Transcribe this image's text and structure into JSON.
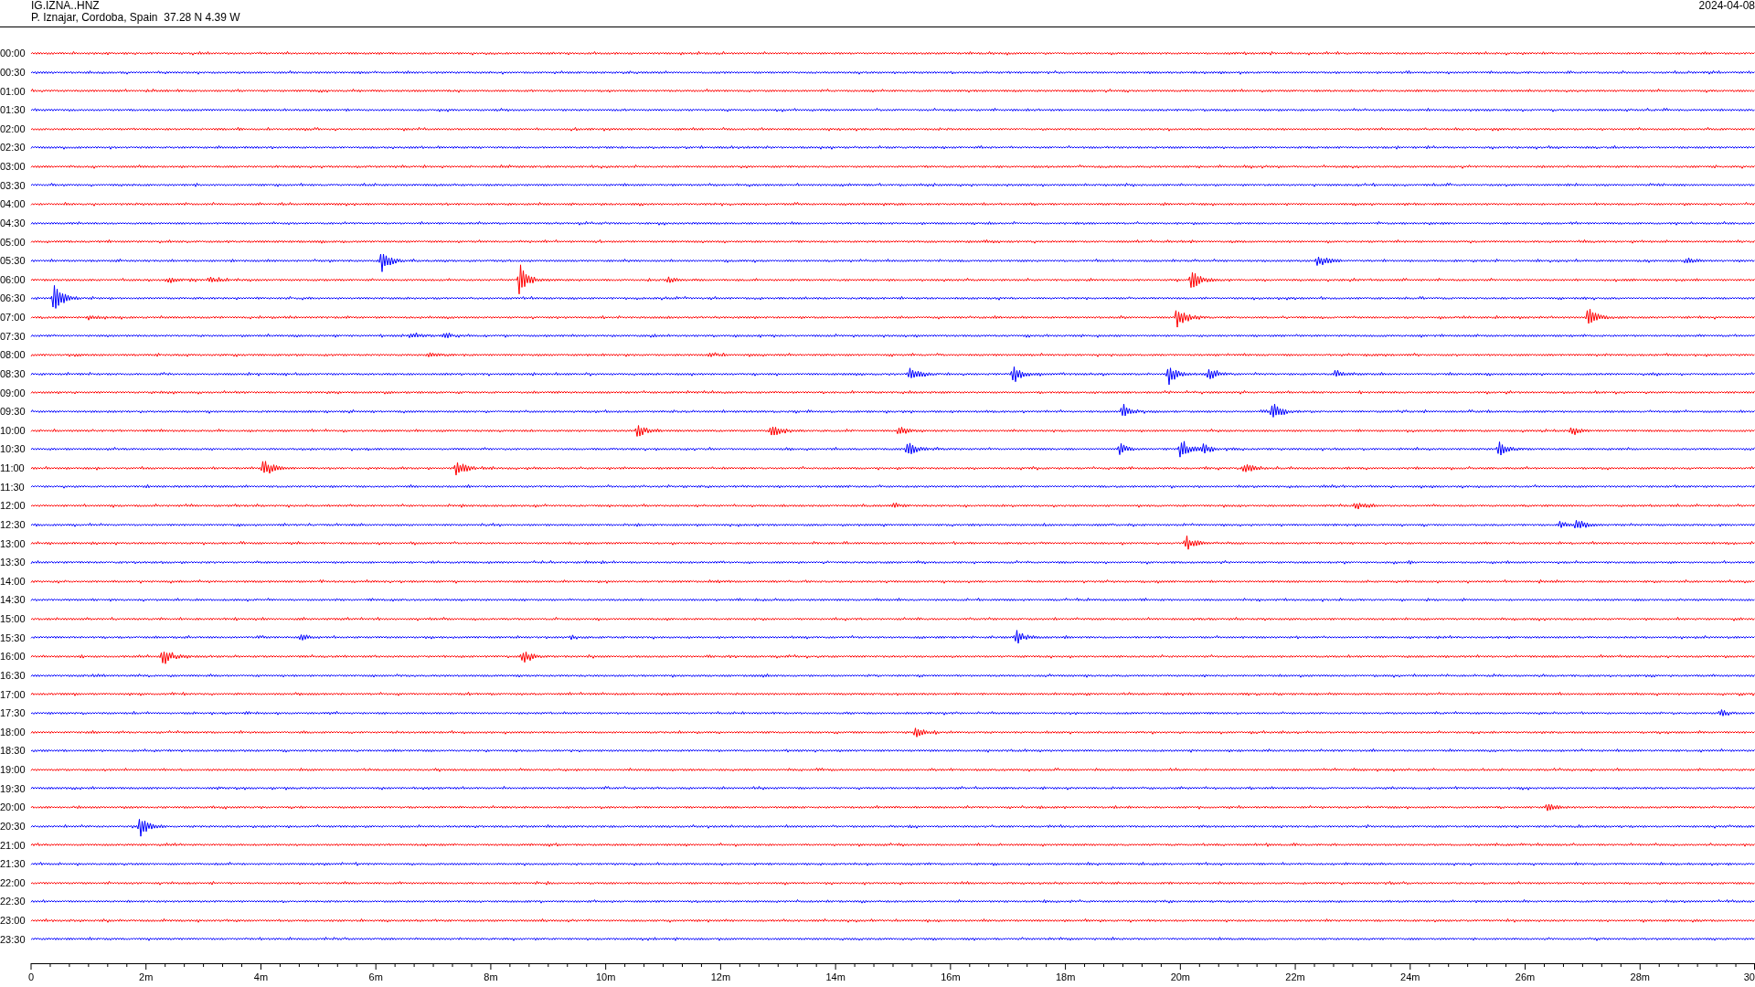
{
  "header": {
    "station": "IG.IZNA..HNZ",
    "location": "P. Iznajar, Cordoba, Spain  37.28 N 4.39 W",
    "date": "2024-04-08"
  },
  "rows": [
    {
      "time": "00:00",
      "color": "#ff0000"
    },
    {
      "time": "00:30",
      "color": "#0000ff"
    },
    {
      "time": "01:00",
      "color": "#ff0000"
    },
    {
      "time": "01:30",
      "color": "#0000ff"
    },
    {
      "time": "02:00",
      "color": "#ff0000"
    },
    {
      "time": "02:30",
      "color": "#0000ff"
    },
    {
      "time": "03:00",
      "color": "#ff0000"
    },
    {
      "time": "03:30",
      "color": "#0000ff"
    },
    {
      "time": "04:00",
      "color": "#ff0000"
    },
    {
      "time": "04:30",
      "color": "#0000ff"
    },
    {
      "time": "05:00",
      "color": "#ff0000"
    },
    {
      "time": "05:30",
      "color": "#0000ff"
    },
    {
      "time": "06:00",
      "color": "#ff0000"
    },
    {
      "time": "06:30",
      "color": "#0000ff"
    },
    {
      "time": "07:00",
      "color": "#ff0000"
    },
    {
      "time": "07:30",
      "color": "#0000ff"
    },
    {
      "time": "08:00",
      "color": "#ff0000"
    },
    {
      "time": "08:30",
      "color": "#0000ff"
    },
    {
      "time": "09:00",
      "color": "#ff0000"
    },
    {
      "time": "09:30",
      "color": "#0000ff"
    },
    {
      "time": "10:00",
      "color": "#ff0000"
    },
    {
      "time": "10:30",
      "color": "#0000ff"
    },
    {
      "time": "11:00",
      "color": "#ff0000"
    },
    {
      "time": "11:30",
      "color": "#0000ff"
    },
    {
      "time": "12:00",
      "color": "#ff0000"
    },
    {
      "time": "12:30",
      "color": "#0000ff"
    },
    {
      "time": "13:00",
      "color": "#ff0000"
    },
    {
      "time": "13:30",
      "color": "#0000ff"
    },
    {
      "time": "14:00",
      "color": "#ff0000"
    },
    {
      "time": "14:30",
      "color": "#0000ff"
    },
    {
      "time": "15:00",
      "color": "#ff0000"
    },
    {
      "time": "15:30",
      "color": "#0000ff"
    },
    {
      "time": "16:00",
      "color": "#ff0000"
    },
    {
      "time": "16:30",
      "color": "#0000ff"
    },
    {
      "time": "17:00",
      "color": "#ff0000"
    },
    {
      "time": "17:30",
      "color": "#0000ff"
    },
    {
      "time": "18:00",
      "color": "#ff0000"
    },
    {
      "time": "18:30",
      "color": "#0000ff"
    },
    {
      "time": "19:00",
      "color": "#ff0000"
    },
    {
      "time": "19:30",
      "color": "#0000ff"
    },
    {
      "time": "20:00",
      "color": "#ff0000"
    },
    {
      "time": "20:30",
      "color": "#0000ff"
    },
    {
      "time": "21:00",
      "color": "#ff0000"
    },
    {
      "time": "21:30",
      "color": "#0000ff"
    },
    {
      "time": "22:00",
      "color": "#ff0000"
    },
    {
      "time": "22:30",
      "color": "#0000ff"
    },
    {
      "time": "23:00",
      "color": "#ff0000"
    },
    {
      "time": "23:30",
      "color": "#0000ff"
    }
  ],
  "time_axis": {
    "labels": [
      "0",
      "2m",
      "4m",
      "6m",
      "8m",
      "10m",
      "12m",
      "14m",
      "16m",
      "18m",
      "20m",
      "22m",
      "24m",
      "26m",
      "28m",
      "30"
    ]
  }
}
